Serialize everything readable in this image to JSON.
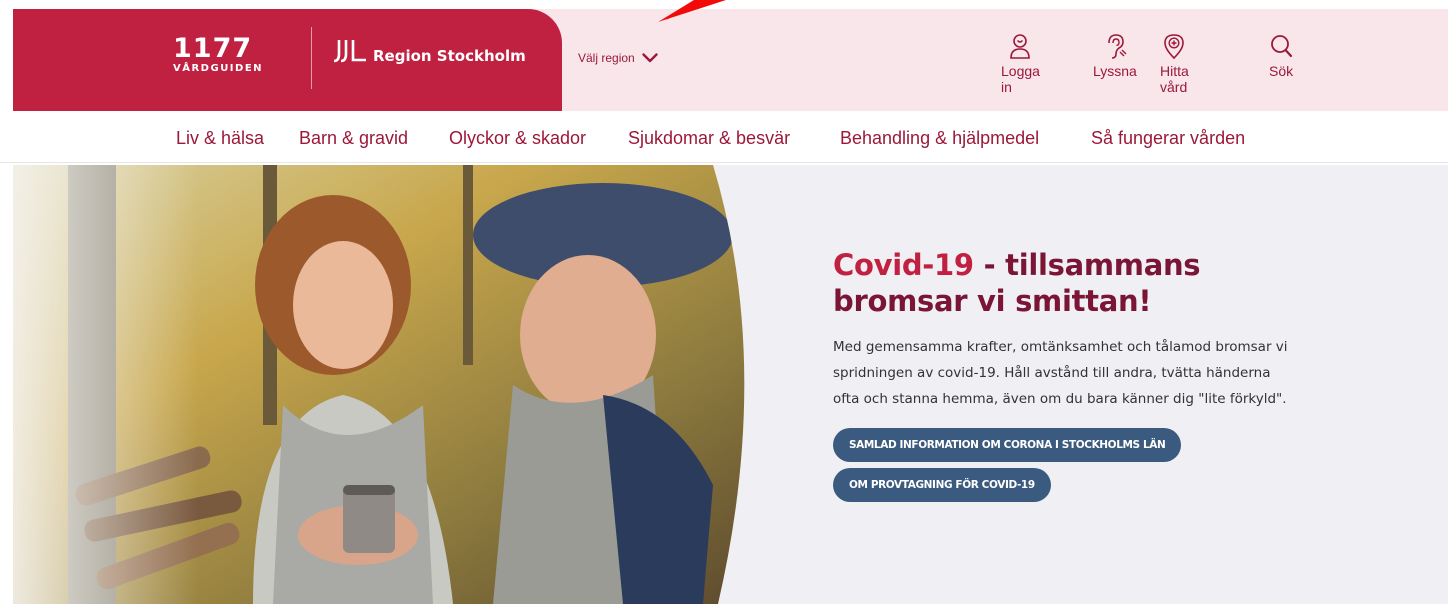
{
  "header": {
    "logo_1177": {
      "number": "1177",
      "subtitle": "VÅRDGUIDEN"
    },
    "logo_region": {
      "text": "Region Stockholm"
    },
    "region_select": "Välj region",
    "tools": {
      "login": "Logga in",
      "listen": "Lyssna",
      "find_care": "Hitta vård",
      "search": "Sök"
    }
  },
  "nav": {
    "items": [
      {
        "label": "Liv & hälsa"
      },
      {
        "label": "Barn & gravid"
      },
      {
        "label": "Olyckor & skador"
      },
      {
        "label": "Sjukdomar & besvär"
      },
      {
        "label": "Behandling & hjälpmedel"
      },
      {
        "label": "Så fungerar vården"
      }
    ]
  },
  "hero": {
    "title_highlight": "Covid-19",
    "title_rest": " - tillsammans bromsar vi smittan!",
    "body": "Med gemensamma krafter, omtänksamhet och tålamod bromsar vi spridningen av covid-19. Håll avstånd till andra, tvätta händerna ofta och stanna hemma, även om du bara känner dig \"lite förkyld\".",
    "button_primary": "SAMLAD INFORMATION OM CORONA I STOCKHOLMS LÄN",
    "button_secondary": "OM PROVTAGNING FÖR COVID-19"
  },
  "colors": {
    "brand_red": "#c12141",
    "brand_dark": "#7b1535",
    "header_pink": "#f9e6ea",
    "button_blue": "#3b5a7f",
    "annotation_arrow": "#f20a0a"
  }
}
